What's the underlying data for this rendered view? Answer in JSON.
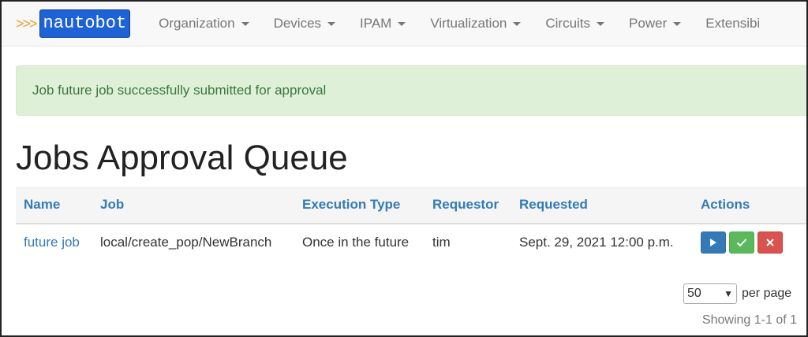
{
  "brand": {
    "arrows": ">>>",
    "name": "nautobot"
  },
  "nav": {
    "items": [
      {
        "label": "Organization"
      },
      {
        "label": "Devices"
      },
      {
        "label": "IPAM"
      },
      {
        "label": "Virtualization"
      },
      {
        "label": "Circuits"
      },
      {
        "label": "Power"
      },
      {
        "label": "Extensibi"
      }
    ]
  },
  "alert": {
    "message": "Job future job successfully submitted for approval"
  },
  "page": {
    "title": "Jobs Approval Queue"
  },
  "table": {
    "headers": [
      "Name",
      "Job",
      "Execution Type",
      "Requestor",
      "Requested",
      "Actions"
    ],
    "rows": [
      {
        "name": "future job",
        "job": "local/create_pop/NewBranch",
        "execution_type": "Once in the future",
        "requestor": "tim",
        "requested": "Sept. 29, 2021 12:00 p.m."
      }
    ]
  },
  "actions": {
    "run_icon": "play-icon",
    "approve_icon": "check-icon",
    "deny_icon": "x-icon"
  },
  "pagination": {
    "per_page_value": "50",
    "per_page_label": "per page",
    "showing": "Showing 1-1 of 1"
  },
  "colors": {
    "link": "#337ab7",
    "alert_bg": "#dff0d8",
    "alert_text": "#3c763d",
    "brand_bg": "#1e63d6",
    "run": "#337ab7",
    "approve": "#5cb85c",
    "deny": "#d9534f"
  }
}
